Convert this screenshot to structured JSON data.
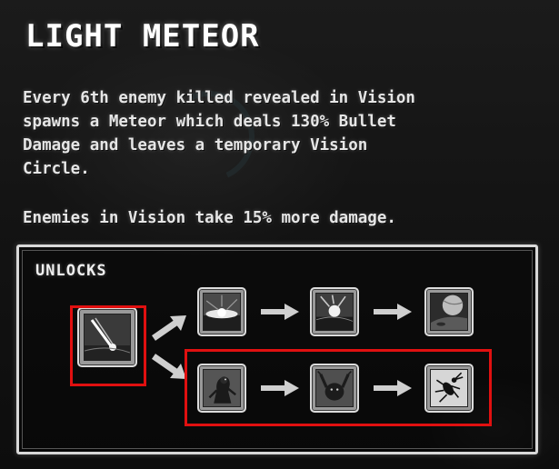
{
  "ability": {
    "title": "LIGHT METEOR",
    "description_lines": [
      "Every 6th enemy killed revealed in Vision",
      "spawns a Meteor which deals 130% Bullet",
      "Damage and leaves a temporary Vision",
      "Circle."
    ],
    "extra_line": "Enemies in Vision take 15% more damage."
  },
  "unlocks": {
    "label": "UNLOCKS",
    "root": {
      "icon": "meteor-strike-icon"
    },
    "branch_top": [
      {
        "icon": "impact-flash-icon"
      },
      {
        "icon": "meteor-shower-icon"
      },
      {
        "icon": "planet-crater-icon"
      }
    ],
    "branch_bottom": [
      {
        "icon": "hunched-creature-icon"
      },
      {
        "icon": "clawed-beast-icon"
      },
      {
        "icon": "insect-bug-icon"
      }
    ],
    "highlight_color": "#e01010"
  }
}
